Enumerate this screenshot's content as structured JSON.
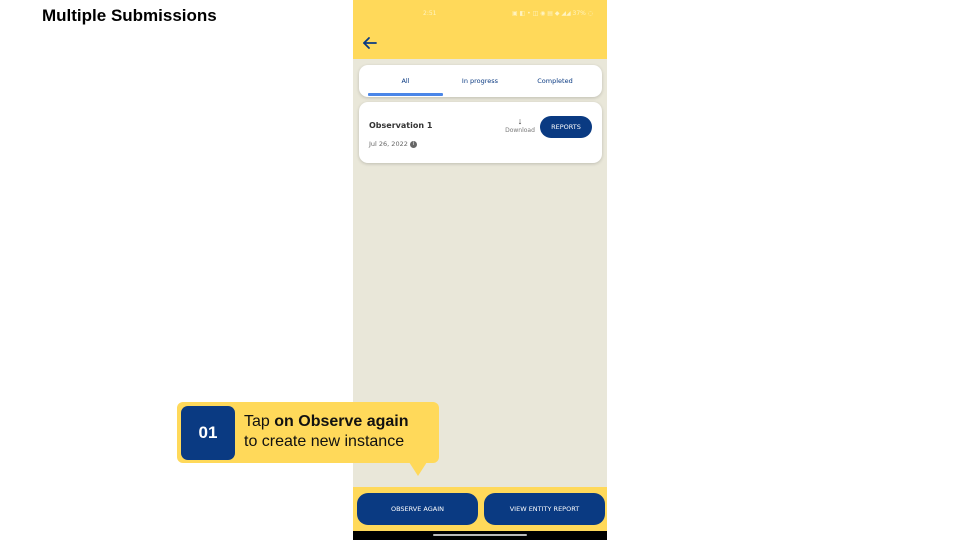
{
  "slide": {
    "title": "Multiple Submissions"
  },
  "status_bar": {
    "time": "2:51",
    "icons": "▣ ◧ •  ◫ ◉ ▤ ◆ ◢◢ 37% ◌"
  },
  "header": {
    "back_icon": "arrow-left-icon"
  },
  "tabs": [
    {
      "label": "All",
      "selected": true
    },
    {
      "label": "In progress",
      "selected": false
    },
    {
      "label": "Completed",
      "selected": false
    }
  ],
  "observation": {
    "title": "Observation 1",
    "date": "Jul 26, 2022",
    "info_icon": "i",
    "download_icon": "↓",
    "download_label": "Download",
    "reports_label": "REPORTS"
  },
  "bottom_actions": {
    "observe_again": "OBSERVE AGAIN",
    "view_entity_report": "VIEW ENTITY REPORT"
  },
  "callout": {
    "step": "01",
    "line1_prefix": "Tap ",
    "line1_bold": "on Observe again",
    "line2": "to create new instance"
  },
  "colors": {
    "brand_yellow": "#ffd95a",
    "brand_blue": "#0a3a82",
    "tab_underline": "#4a86e8",
    "background": "#e9e7d9"
  }
}
